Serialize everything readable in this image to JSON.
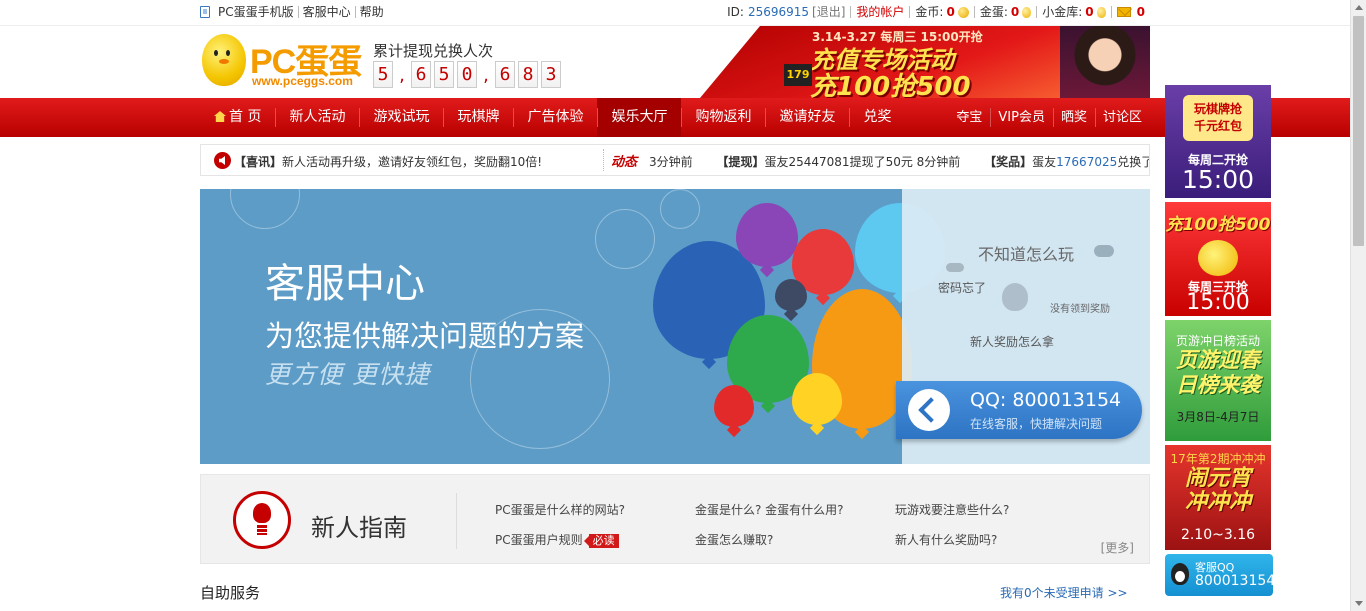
{
  "topbar": {
    "mobile": "PC蛋蛋手机版",
    "service": "客服中心",
    "help": "帮助",
    "id_label": "ID:",
    "id_value": "25696915",
    "logout": "[退出]",
    "my_account": "我的帐户",
    "gold_label": "金币:",
    "gold_value": "0",
    "egg_label": "金蛋:",
    "egg_value": "0",
    "vault_label": "小金库:",
    "vault_value": "0",
    "mail_value": "0"
  },
  "header": {
    "logo_text": "PC蛋蛋",
    "logo_url": "www.pceggs.com",
    "counter_label": "累计提现兑换人次",
    "counter_digits": [
      "5",
      ",",
      "6",
      "5",
      "0",
      ",",
      "6",
      "8",
      "3"
    ],
    "banner_date": "3.14-3.27 每周三 15:00开抢",
    "banner_title": "充值专场活动",
    "banner_sub": "充100抢500",
    "banner_badge": "179"
  },
  "nav": {
    "items": [
      "首 页",
      "新人活动",
      "游戏试玩",
      "玩棋牌",
      "广告体验",
      "娱乐大厅",
      "购物返利",
      "邀请好友",
      "兑奖"
    ],
    "right_items": [
      "夺宝",
      "VIP会员",
      "晒奖",
      "讨论区"
    ],
    "active_index": 5
  },
  "ticker": {
    "news_tag": "【喜讯】",
    "news_text": "新人活动再升级，邀请好友领红包，奖励翻10倍!",
    "dyn_label": "动态",
    "dyn_time1": "3分钟前",
    "dyn_tag2": "【提现】",
    "dyn_text2": "蛋友25447081提现了50元 8分钟前",
    "dyn_tag3": "【奖品】",
    "dyn_text3": "蛋友",
    "dyn_id3": "17667025",
    "dyn_text3b": "兑换了"
  },
  "banner": {
    "title": "客服中心",
    "subtitle": "为您提供解决问题的方案",
    "slogan": "更方便  更快捷",
    "faq1": "不知道怎么玩",
    "faq2": "密码忘了",
    "faq3": "没有领到奖励",
    "faq4": "新人奖励怎么拿",
    "qq_number": "QQ: 800013154",
    "qq_desc": "在线客服，快捷解决问题"
  },
  "guide": {
    "title": "新人指南",
    "links": [
      "PC蛋蛋是什么样的网站?",
      "金蛋是什么? 金蛋有什么用?",
      "玩游戏要注意些什么?",
      "PC蛋蛋用户规则",
      "金蛋怎么赚取?",
      "新人有什么奖励吗?"
    ],
    "must_read": "必读",
    "more": "[更多]"
  },
  "selfserve": {
    "title": "自助服务",
    "pending": "我有0个未受理申请 >>"
  },
  "sidebar": {
    "s1_card": "玩棋牌抢\n千元红包",
    "s1_week": "每周二开抢",
    "s1_time": "15:00",
    "s2_title": "充100抢500",
    "s2_week": "每周三开抢",
    "s2_time": "15:00",
    "s3_top": "页游冲日榜活动",
    "s3_title": "页游迎春\n日榜来袭",
    "s3_date": "3月8日-4月7日",
    "s4_top": "17年第2期冲冲冲",
    "s4_title": "闹元宵\n冲冲冲",
    "s4_date": "2.10~3.16",
    "s5_label": "客服QQ",
    "s5_number": "800013154"
  },
  "colors": {
    "brand_red": "#c40000",
    "nav_red": "#e11b1b",
    "banner_blue": "#5c9cc7",
    "link_blue": "#2a6bb5"
  }
}
